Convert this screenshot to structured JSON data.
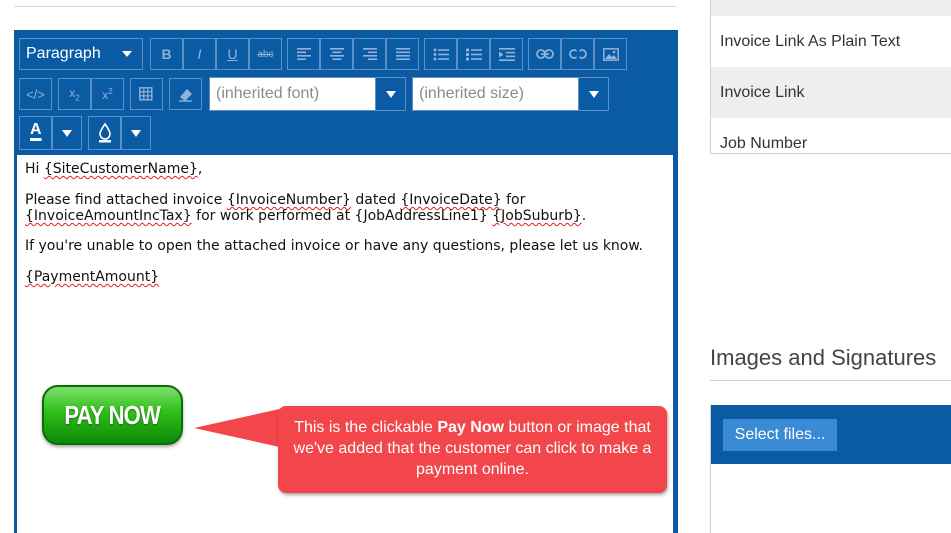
{
  "editor": {
    "block_format": "Paragraph",
    "font_family": "(inherited font)",
    "font_size": "(inherited size)",
    "text_color_glyph": "A",
    "colors": {
      "toolbar": "#0a5aa4",
      "text_color_swatch": "#ffffff"
    }
  },
  "content": {
    "greeting_prefix": "Hi ",
    "greeting_var": "{SiteCustomerName}",
    "greeting_suffix": ",",
    "line2_a": "Please find attached invoice ",
    "line2_var1": "{InvoiceNumber}",
    "line2_b": " dated ",
    "line2_var2": "{InvoiceDate}",
    "line2_c": " for",
    "line3_var1": "{InvoiceAmountIncTax}",
    "line3_b": " for work performed at {JobAddressLine1} ",
    "line3_var2": "{JobSuburb}",
    "line3_c": ".",
    "line4": "If you're unable to open the attached invoice or have any questions, please let us know.",
    "payment_var": "{PaymentAmount}",
    "pay_button_label": "PAY NOW"
  },
  "callout": {
    "prefix": "This is the clickable ",
    "bold": "Pay Now",
    "suffix": " button or image that we've added that the customer can click to make a payment online.",
    "color": "#f2464b"
  },
  "right_panel": {
    "items": [
      "Invoice Link As Plain Text",
      "Invoice Link",
      "Job Number"
    ],
    "section_title": "Images and Signatures",
    "select_files_label": "Select files..."
  }
}
